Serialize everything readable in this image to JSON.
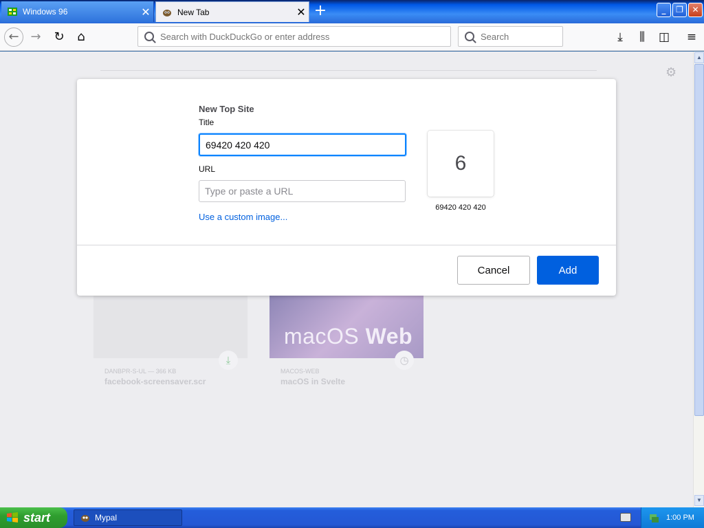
{
  "browser": {
    "tabs": [
      {
        "label": "Windows 96",
        "icon": "windows96-logo-icon",
        "close": "✕"
      },
      {
        "label": "New Tab",
        "icon": "firefox-logo-icon",
        "close": "✕"
      }
    ],
    "new_tab_symbol": "+",
    "url_placeholder": "Search with DuckDuckGo or enter address",
    "search_placeholder": "Search"
  },
  "new_tab_page": {
    "cards": [
      {
        "meta": "DANBPR-S-UL — 366 KB",
        "title": "facebook-screensaver.scr"
      },
      {
        "image_text_light": "macOS",
        "image_text_bold": "Web",
        "meta": "MACOS-WEB",
        "title": "macOS in Svelte"
      }
    ]
  },
  "dialog": {
    "title": "New Top Site",
    "title_label": "Title",
    "title_value": "69420 420 420",
    "url_label": "URL",
    "url_placeholder": "Type or paste a URL",
    "custom_image_link": "Use a custom image...",
    "preview_letter": "6",
    "preview_caption": "69420 420 420",
    "cancel_label": "Cancel",
    "add_label": "Add"
  },
  "taskbar": {
    "start_label": "start",
    "task_label": "Mypal",
    "clock": "1:00 PM"
  },
  "colors": {
    "accent": "#0060df",
    "focus": "#0a84ff",
    "taskbar": "#245edb",
    "start": "#2f9e2f"
  }
}
